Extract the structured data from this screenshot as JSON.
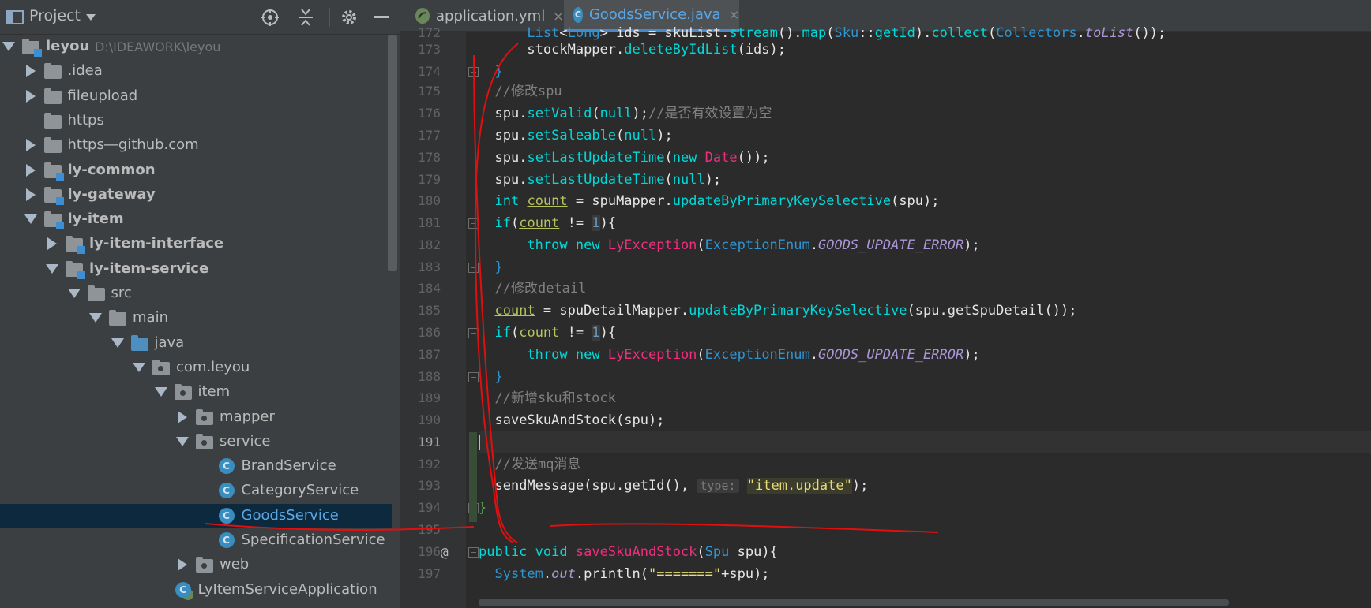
{
  "project": {
    "title": "Project",
    "tree": [
      {
        "label": "leyou",
        "path": "D:\\IDEAWORK\\leyou",
        "bold": true,
        "depth": 0,
        "arrow": "down",
        "icon": "module-folder"
      },
      {
        "label": ".idea",
        "depth": 1,
        "arrow": "right",
        "icon": "folder"
      },
      {
        "label": "fileupload",
        "depth": 1,
        "arrow": "right",
        "icon": "folder"
      },
      {
        "label": "https",
        "depth": 1,
        "arrow": "none",
        "icon": "folder"
      },
      {
        "label": "https―github.com",
        "depth": 1,
        "arrow": "right",
        "icon": "folder"
      },
      {
        "label": "ly-common",
        "bold": true,
        "depth": 1,
        "arrow": "right",
        "icon": "module-folder"
      },
      {
        "label": "ly-gateway",
        "bold": true,
        "depth": 1,
        "arrow": "right",
        "icon": "module-folder"
      },
      {
        "label": "ly-item",
        "bold": true,
        "depth": 1,
        "arrow": "down",
        "icon": "module-folder"
      },
      {
        "label": "ly-item-interface",
        "bold": true,
        "depth": 2,
        "arrow": "right",
        "icon": "module-folder"
      },
      {
        "label": "ly-item-service",
        "bold": true,
        "depth": 2,
        "arrow": "down",
        "icon": "module-folder"
      },
      {
        "label": "src",
        "depth": 3,
        "arrow": "down",
        "icon": "folder"
      },
      {
        "label": "main",
        "depth": 4,
        "arrow": "down",
        "icon": "folder"
      },
      {
        "label": "java",
        "depth": 5,
        "arrow": "down",
        "icon": "source-folder"
      },
      {
        "label": "com.leyou",
        "depth": 6,
        "arrow": "down",
        "icon": "package-folder"
      },
      {
        "label": "item",
        "depth": 7,
        "arrow": "down",
        "icon": "package-folder"
      },
      {
        "label": "mapper",
        "depth": 8,
        "arrow": "right",
        "icon": "package-folder"
      },
      {
        "label": "service",
        "depth": 8,
        "arrow": "down",
        "icon": "package-folder"
      },
      {
        "label": "BrandService",
        "depth": 9,
        "arrow": "none",
        "icon": "class"
      },
      {
        "label": "CategoryService",
        "depth": 9,
        "arrow": "none",
        "icon": "class"
      },
      {
        "label": "GoodsService",
        "depth": 9,
        "arrow": "none",
        "icon": "class",
        "selected": true
      },
      {
        "label": "SpecificationService",
        "depth": 9,
        "arrow": "none",
        "icon": "class"
      },
      {
        "label": "web",
        "depth": 8,
        "arrow": "right",
        "icon": "package-folder"
      },
      {
        "label": "LyItemServiceApplication",
        "depth": 7,
        "arrow": "none",
        "icon": "spring-class"
      }
    ]
  },
  "tabs": [
    {
      "label": "application.yml",
      "close": "×",
      "active": false,
      "icon": "yml-icon"
    },
    {
      "label": "GoodsService.java",
      "close": "×",
      "active": true,
      "icon": "class-icon"
    }
  ],
  "editor": {
    "line_numbers": [
      "172",
      "173",
      "174",
      "175",
      "176",
      "177",
      "178",
      "179",
      "180",
      "181",
      "182",
      "183",
      "184",
      "185",
      "186",
      "187",
      "188",
      "189",
      "190",
      "191",
      "192",
      "193",
      "194",
      "195",
      "196",
      "197"
    ],
    "current_line": "191",
    "annotation_color": "#e01010"
  }
}
